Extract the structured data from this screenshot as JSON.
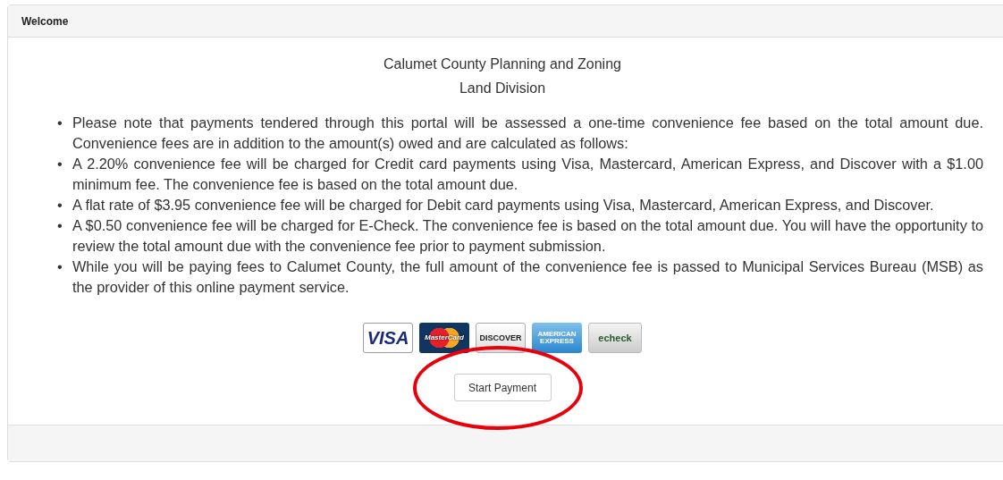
{
  "panel": {
    "title": "Welcome"
  },
  "heading": [
    "Calumet County Planning and Zoning",
    "Land Division"
  ],
  "notes": [
    {
      "bullet": "•",
      "text": "Please note that payments tendered through this portal will be assessed a one-time convenience fee based on the total amount due. Convenience fees are in addition to the amount(s) owed and are calculated as follows:"
    },
    {
      "bullet": "•",
      "text": "A 2.20% convenience fee will be charged for Credit card payments using Visa, Mastercard, American Express, and Discover with a $1.00 minimum fee. The convenience fee is based on the total amount due."
    },
    {
      "bullet": "•",
      "text": "A flat rate of $3.95 convenience fee will be charged for Debit card payments using Visa, Mastercard, American Express, and Discover."
    },
    {
      "bullet": "•",
      "text": "A $0.50 convenience fee will be charged for E-Check. The convenience fee is based on the total amount due. You will have the opportunity to review the total amount due with the convenience fee prior to payment submission."
    },
    {
      "bullet": "•",
      "text": "While you will be paying fees to Calumet County, the full amount of the convenience fee is passed to Municipal Services Bureau (MSB) as the provider of this online payment service."
    }
  ],
  "payment_methods": [
    {
      "kind": "visa",
      "label": "VISA"
    },
    {
      "kind": "mastercard",
      "label": "MasterCard"
    },
    {
      "kind": "discover",
      "label": "DISCOVER"
    },
    {
      "kind": "amex",
      "label": "AMERICAN EXPRESS"
    },
    {
      "kind": "echeck",
      "label": "echeck"
    }
  ],
  "start_button": {
    "label": "Start Payment",
    "highlighted": true
  }
}
